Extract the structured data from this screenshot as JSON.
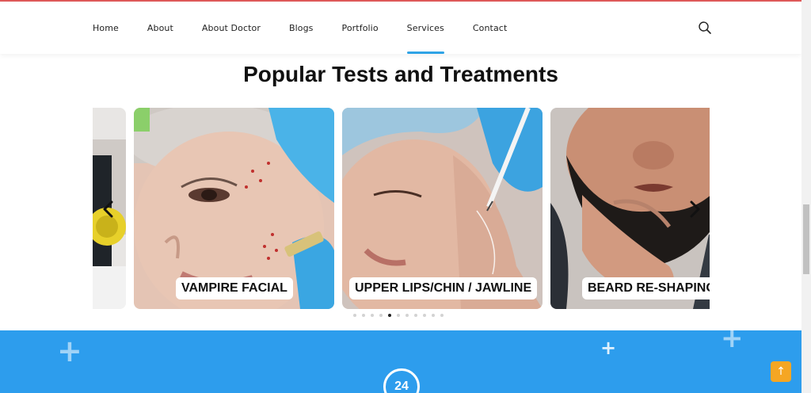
{
  "nav": {
    "items": [
      {
        "label": "Home"
      },
      {
        "label": "About"
      },
      {
        "label": "About Doctor"
      },
      {
        "label": "Blogs"
      },
      {
        "label": "Portfolio"
      },
      {
        "label": "Services"
      },
      {
        "label": "Contact"
      }
    ],
    "active": "Services",
    "search_icon": "search-icon"
  },
  "section": {
    "title": "Popular Tests and Treatments"
  },
  "carousel": {
    "cards": [
      {
        "label": ""
      },
      {
        "label": "VAMPIRE FACIAL"
      },
      {
        "label": "UPPER LIPS/CHIN / JAWLINE"
      },
      {
        "label": "BEARD RE-SHAPING"
      }
    ],
    "prev_icon": "chevron-left-icon",
    "next_icon": "chevron-right-icon",
    "dot_count": 11,
    "active_dot": 5
  },
  "footer_band": {
    "badge_text": "24",
    "color": "#2d9ded"
  },
  "scroll_top": {
    "glyph": "↑",
    "icon": "arrow-up-icon",
    "color": "#f5a623"
  }
}
